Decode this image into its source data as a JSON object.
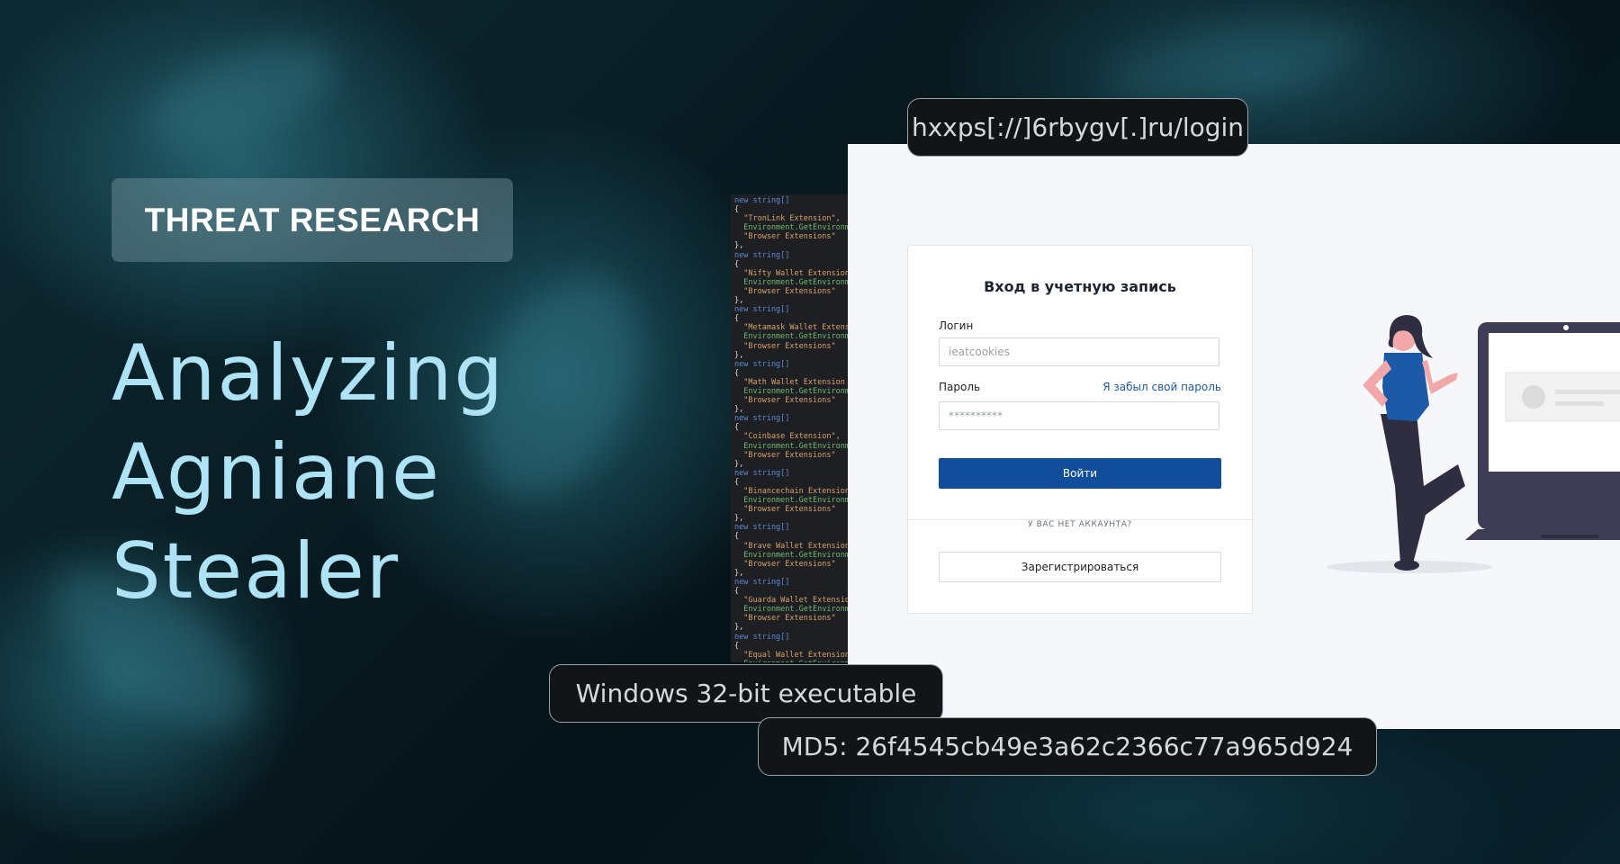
{
  "banner": {
    "badge": "THREAT RESEARCH",
    "title_lines": [
      "Analyzing",
      "Agniane",
      "Stealer"
    ]
  },
  "callouts": {
    "url": "hxxps[://]6rbygv[.]ru/login",
    "file_type": "Windows 32-bit executable",
    "md5": "MD5: 26f4545cb49e3a62c2366c77a965d924"
  },
  "code_snippet": {
    "keyword": "new string[]",
    "browser_label": "\"Browser Extensions\"",
    "entries": [
      "\"TronLink Extension\",",
      "\"Nifty Wallet Extension",
      "\"Metamask Wallet Extens",
      "\"Math Wallet Extension",
      "\"Coinbase Extension\",",
      "\"Binancechain Extension",
      "\"Brave Wallet Extension",
      "\"Guarda Wallet Extensio",
      "\"Equal Wallet Extension"
    ]
  },
  "login_form": {
    "title": "Вход в учетную запись",
    "login_label": "Логин",
    "login_value": "ieatcookies",
    "password_label": "Пароль",
    "password_value": "**********",
    "forgot_link": "Я забыл свой пароль",
    "submit_label": "Войти",
    "no_account_text": "У ВАС НЕТ АККАУНТА?",
    "register_label": "Зарегистрироваться"
  },
  "colors": {
    "title": "#aee3f6",
    "primary_button": "#104e9c",
    "link": "#1a5aa8",
    "illustration_shirt": "#1c5aa8",
    "illustration_skin": "#f2a8a8",
    "laptop": "#3f3d56"
  }
}
